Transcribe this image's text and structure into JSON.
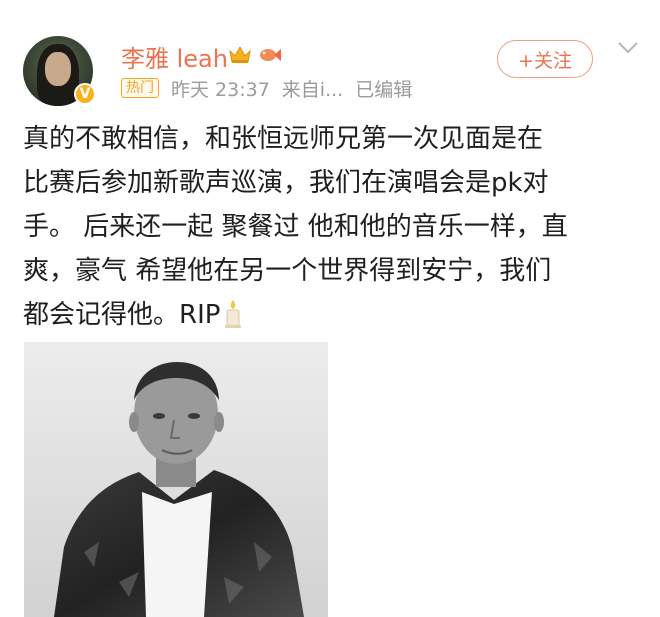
{
  "post": {
    "author": "李雅 leah",
    "badge_hot": "热门",
    "time": "昨天 23:37",
    "source": "来自i...",
    "edited": "已编辑",
    "follow_label": "+关注",
    "content_lines": [
      "真的不敢相信，和张恒远师兄第一次见面是在",
      "比赛后参加新歌声巡演，我们在演唱会是pk对",
      "手。 后来还一起 聚餐过 他和他的音乐一样，直",
      "爽，豪气 希望他在另一个世界得到安宁，我们",
      "都会记得他。RIP"
    ]
  },
  "icons": {
    "verified": "verified-v-icon",
    "crown": "vip-crown-icon",
    "fish": "fish-badge-icon",
    "chevron": "chevron-down-icon",
    "candle": "candle-emoji-icon"
  },
  "colors": {
    "accent": "#eb7350",
    "hot_badge": "#f5a623",
    "meta_text": "#9b9b9b"
  }
}
